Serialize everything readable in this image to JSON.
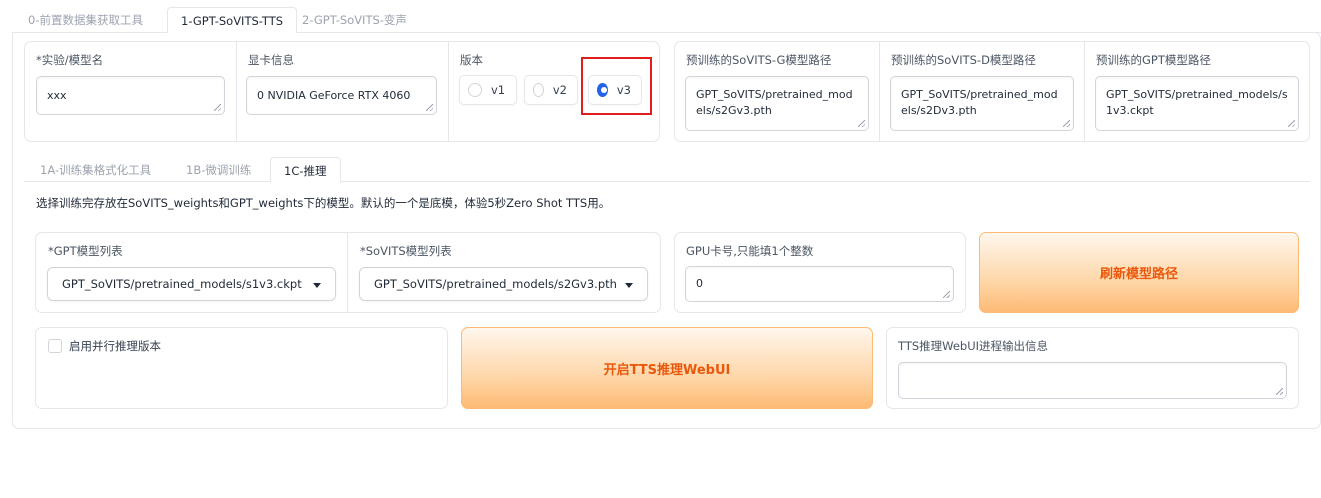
{
  "top_tabs": [
    {
      "label": "0-前置数据集获取工具",
      "active": false
    },
    {
      "label": "1-GPT-SoVITS-TTS",
      "active": true
    },
    {
      "label": "2-GPT-SoVITS-变声",
      "active": false
    }
  ],
  "settings": {
    "experiment": {
      "label": "*实验/模型名",
      "value": "xxx"
    },
    "gpu_info": {
      "label": "显卡信息",
      "value": "0 NVIDIA GeForce RTX 4060"
    },
    "version": {
      "label": "版本",
      "options": [
        {
          "label": "v1",
          "checked": false
        },
        {
          "label": "v2",
          "checked": false
        },
        {
          "label": "v3",
          "checked": true
        }
      ],
      "highlight_color": "#e11d1d"
    },
    "sovits_g": {
      "label": "预训练的SoVITS-G模型路径",
      "value": "GPT_SoVITS/pretrained_models/s2Gv3.pth"
    },
    "sovits_d": {
      "label": "预训练的SoVITS-D模型路径",
      "value": "GPT_SoVITS/pretrained_models/s2Dv3.pth"
    },
    "gpt_path": {
      "label": "预训练的GPT模型路径",
      "value": "GPT_SoVITS/pretrained_models/s1v3.ckpt"
    }
  },
  "sub_tabs": [
    {
      "label": "1A-训练集格式化工具",
      "active": false
    },
    {
      "label": "1B-微调训练",
      "active": false
    },
    {
      "label": "1C-推理",
      "active": true
    }
  ],
  "inference": {
    "description": "选择训练完存放在SoVITS_weights和GPT_weights下的模型。默认的一个是底模，体验5秒Zero Shot TTS用。",
    "gpt_list": {
      "label": "*GPT模型列表",
      "selected": "GPT_SoVITS/pretrained_models/s1v3.ckpt"
    },
    "sovits_list": {
      "label": "*SoVITS模型列表",
      "selected": "GPT_SoVITS/pretrained_models/s2Gv3.pth"
    },
    "gpu_number": {
      "label": "GPU卡号,只能填1个整数",
      "value": "0"
    },
    "refresh_button": "刷新模型路径",
    "parallel_checkbox": {
      "label": "启用并行推理版本",
      "checked": false
    },
    "start_button": "开启TTS推理WebUI",
    "output_info": {
      "label": "TTS推理WebUI进程输出信息",
      "value": ""
    }
  },
  "colors": {
    "accent_orange": "#ea580c",
    "radio_blue": "#2563eb"
  }
}
